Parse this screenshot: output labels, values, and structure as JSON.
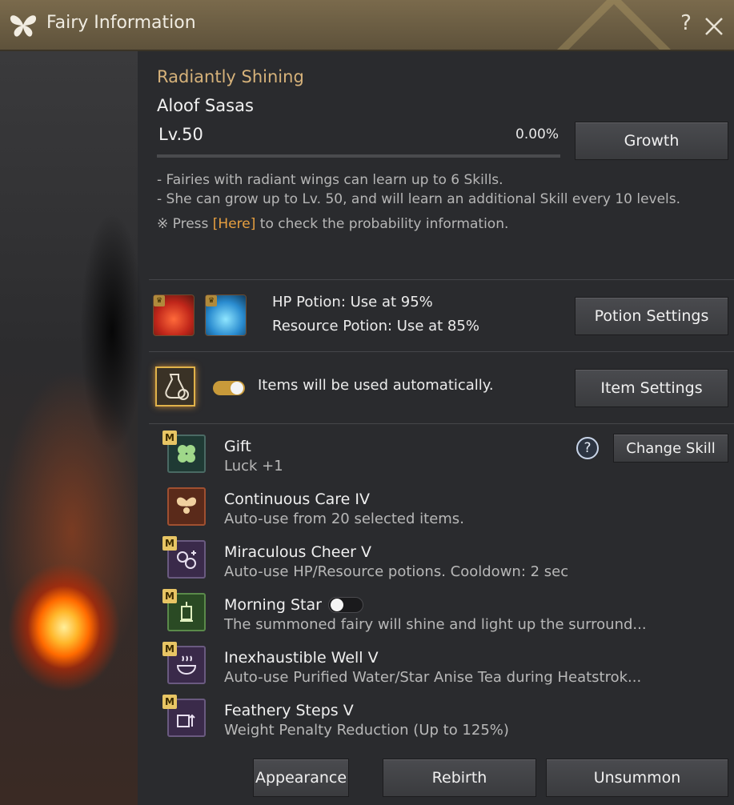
{
  "window": {
    "title": "Fairy Information",
    "help": "?",
    "close": "✕"
  },
  "fairy": {
    "grade": "Radiantly Shining",
    "name": "Aloof Sasas",
    "level": "Lv.50",
    "exp": "0.00%",
    "growth_label": "Growth",
    "notes": [
      "- Fairies with radiant wings can learn up to 6 Skills.",
      "- She can grow up to Lv. 50, and will learn an additional Skill every 10 levels."
    ],
    "prob_prefix": "※ Press ",
    "prob_link": "[Here]",
    "prob_suffix": " to check the probability information."
  },
  "potions": {
    "hp": "HP Potion: Use at 95%",
    "resource": "Resource Potion: Use at 85%",
    "settings_label": "Potion Settings"
  },
  "items": {
    "auto_text": "Items will be used automatically.",
    "settings_label": "Item Settings",
    "auto_enabled": true
  },
  "skills_header": {
    "help": "?",
    "change_label": "Change Skill"
  },
  "skills": [
    {
      "name": "Gift",
      "desc": "Luck +1",
      "badge": "M",
      "icon": "clover-icon"
    },
    {
      "name": "Continuous Care IV",
      "desc": "Auto-use from 20 selected items.",
      "badge": "",
      "icon": "fairy-icon"
    },
    {
      "name": "Miraculous Cheer V",
      "desc": "Auto-use HP/Resource potions. Cooldown: 2 sec",
      "badge": "M",
      "icon": "potions-icon"
    },
    {
      "name": "Morning Star",
      "desc": "The summoned fairy will shine and light up the surround...",
      "badge": "M",
      "icon": "lantern-icon",
      "toggle_on": false
    },
    {
      "name": "Inexhaustible Well V",
      "desc": "Auto-use Purified Water/Star Anise Tea during Heatstrok...",
      "badge": "M",
      "icon": "bowl-icon"
    },
    {
      "name": "Feathery Steps V",
      "desc": "Weight Penalty Reduction (Up to 125%)",
      "badge": "M",
      "icon": "weight-icon"
    }
  ],
  "footer": {
    "appearance": "Appearance",
    "rebirth": "Rebirth",
    "unsummon": "Unsummon"
  },
  "colors": {
    "gold": "#d6b27a",
    "link": "#e8a040",
    "titlebar": "#6e5f45"
  }
}
